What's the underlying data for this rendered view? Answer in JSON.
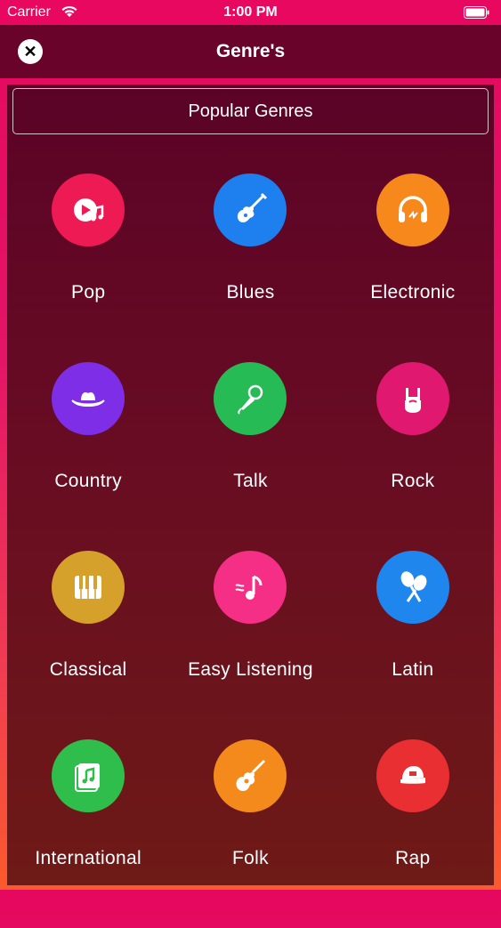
{
  "status_bar": {
    "carrier": "Carrier",
    "time": "1:00 PM"
  },
  "nav": {
    "title": "Genre's",
    "close_icon": "close-icon"
  },
  "section": {
    "title": "Popular Genres"
  },
  "genres": [
    {
      "label": "Pop",
      "icon": "play-music-icon",
      "color": "#ee1a53"
    },
    {
      "label": "Blues",
      "icon": "electric-guitar-icon",
      "color": "#1e7fef"
    },
    {
      "label": "Electronic",
      "icon": "headphones-icon",
      "color": "#f7891c"
    },
    {
      "label": "Country",
      "icon": "cowboy-hat-icon",
      "color": "#7d2ee6"
    },
    {
      "label": "Talk",
      "icon": "microphone-icon",
      "color": "#27bb55"
    },
    {
      "label": "Rock",
      "icon": "rock-hand-icon",
      "color": "#e0186f"
    },
    {
      "label": "Classical",
      "icon": "piano-keys-icon",
      "color": "#d6a12a"
    },
    {
      "label": "Easy Listening",
      "icon": "music-note-icon",
      "color": "#f52f86"
    },
    {
      "label": "Latin",
      "icon": "maracas-icon",
      "color": "#1f86ee"
    },
    {
      "label": "International",
      "icon": "music-file-icon",
      "color": "#2fbe4b"
    },
    {
      "label": "Folk",
      "icon": "acoustic-guitar-icon",
      "color": "#f48a1b"
    },
    {
      "label": "Rap",
      "icon": "cap-icon",
      "color": "#ea2f33"
    }
  ]
}
